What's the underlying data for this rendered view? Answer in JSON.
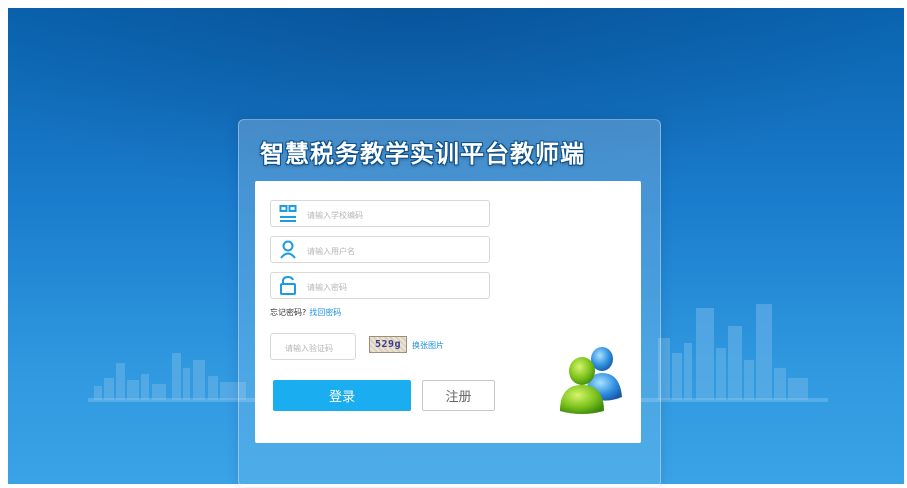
{
  "app": {
    "title": "智慧税务教学实训平台教师端"
  },
  "form": {
    "school_code_placeholder": "请输入学校编码",
    "username_placeholder": "请输入用户名",
    "password_placeholder": "请输入密码",
    "forgot_text": "忘记密码?",
    "find_password_link": "找回密码",
    "captcha_placeholder": "请输入验证码",
    "captcha_code": "529g",
    "refresh_captcha_link": "换张图片",
    "login_label": "登录",
    "register_label": "注册"
  },
  "colors": {
    "background_top": "#0a63ae",
    "background_bottom": "#3aa3e6",
    "accent": "#1aaef0",
    "link": "#1a8fe0"
  },
  "icons": [
    "building-icon",
    "user-icon",
    "lock-icon",
    "users-icon"
  ]
}
